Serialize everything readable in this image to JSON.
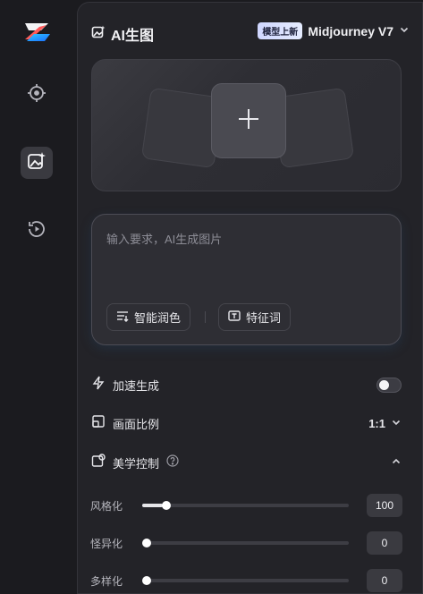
{
  "sidebar": {
    "items": [
      {
        "icon": "logo-icon"
      },
      {
        "icon": "target-icon"
      },
      {
        "icon": "image-sparkle-icon",
        "active": true
      },
      {
        "icon": "history-icon"
      }
    ]
  },
  "header": {
    "title": "AI生图",
    "badge": "模型上新",
    "model": "Midjourney V7"
  },
  "upload": {
    "icon": "plus-icon"
  },
  "prompt": {
    "placeholder": "输入要求，AI生成图片",
    "value": "",
    "chips": [
      {
        "label": "智能润色",
        "icon": "polish-icon"
      },
      {
        "label": "特征词",
        "icon": "text-box-icon"
      }
    ]
  },
  "settings": {
    "speed_label": "加速生成",
    "speed_on": false,
    "ratio_label": "画面比例",
    "ratio_value": "1:1",
    "aesthetic_label": "美学控制"
  },
  "sliders": [
    {
      "label": "风格化",
      "value": "100",
      "fraction": 0.1
    },
    {
      "label": "怪异化",
      "value": "0",
      "fraction": 0.0
    },
    {
      "label": "多样化",
      "value": "0",
      "fraction": 0.0
    }
  ],
  "colors": {
    "background": "#1b1b1f",
    "panel": "#232328",
    "accent_red": "#ff4a6a",
    "accent_blue": "#35a0ff"
  }
}
